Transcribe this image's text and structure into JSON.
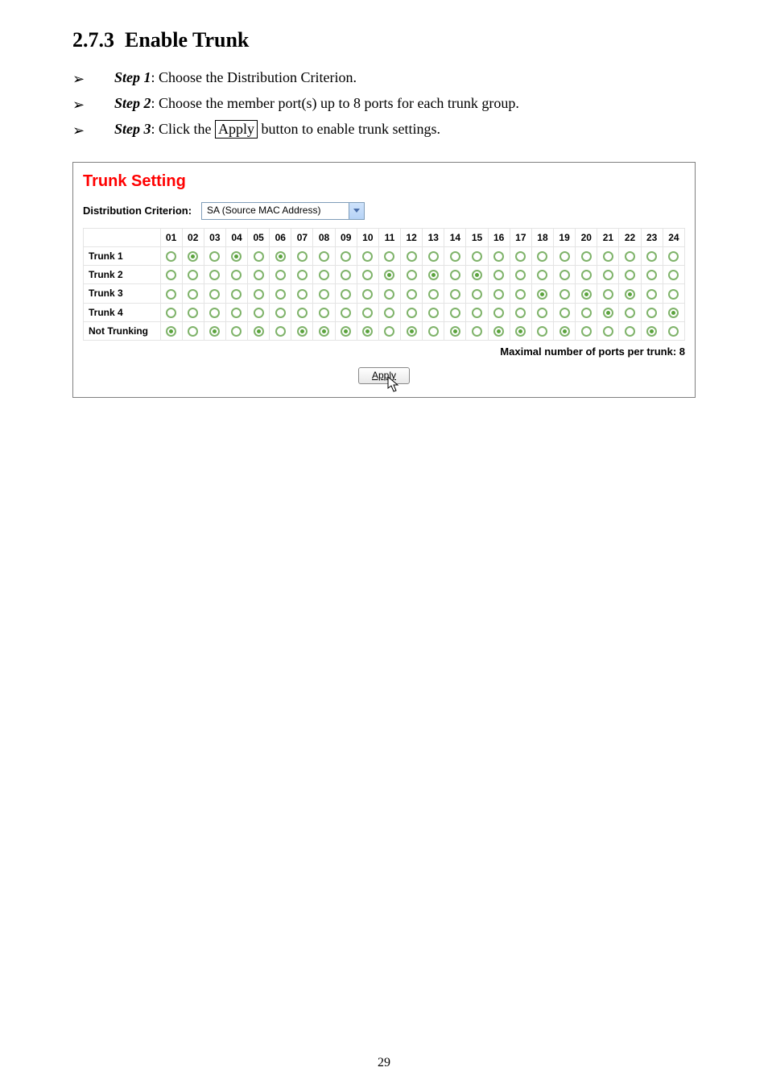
{
  "section": {
    "number": "2.7.3",
    "title": "Enable Trunk"
  },
  "steps": [
    {
      "label": "Step 1",
      "text": ": Choose the Distribution Criterion."
    },
    {
      "label": "Step 2",
      "text": ": Choose the member port(s) up to 8 ports for each trunk group."
    },
    {
      "label": "Step 3",
      "text_before": ": Click the ",
      "apply": "Apply",
      "text_after": " button to enable trunk settings."
    }
  ],
  "shot": {
    "title": "Trunk Setting",
    "criterion_label": "Distribution Criterion:",
    "criterion_value": "SA (Source MAC Address)",
    "columns": [
      "01",
      "02",
      "03",
      "04",
      "05",
      "06",
      "07",
      "08",
      "09",
      "10",
      "11",
      "12",
      "13",
      "14",
      "15",
      "16",
      "17",
      "18",
      "19",
      "20",
      "21",
      "22",
      "23",
      "24"
    ],
    "rows": [
      {
        "label": "Trunk 1",
        "sel": [
          2,
          4,
          6
        ]
      },
      {
        "label": "Trunk 2",
        "sel": [
          11,
          13,
          15
        ]
      },
      {
        "label": "Trunk 3",
        "sel": [
          18,
          20,
          22
        ]
      },
      {
        "label": "Trunk 4",
        "sel": [
          21,
          24
        ]
      },
      {
        "label": "Not Trunking",
        "sel": [
          1,
          3,
          5,
          7,
          8,
          9,
          10,
          12,
          14,
          16,
          17,
          19,
          23
        ]
      }
    ],
    "max_note": "Maximal number of ports per trunk: 8",
    "apply_label": "Apply"
  },
  "page_number": "29"
}
